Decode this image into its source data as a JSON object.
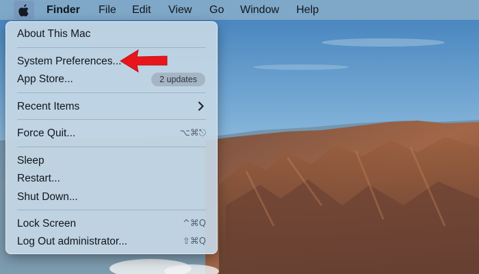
{
  "menubar": {
    "apple_icon": "apple-logo-icon",
    "items": [
      {
        "label": "Finder",
        "bold": true
      },
      {
        "label": "File"
      },
      {
        "label": "Edit"
      },
      {
        "label": "View"
      },
      {
        "label": "Go"
      },
      {
        "label": "Window"
      },
      {
        "label": "Help"
      }
    ]
  },
  "apple_menu": {
    "items": [
      {
        "label": "About This Mac"
      },
      {
        "label": "System Preferences..."
      },
      {
        "label": "App Store...",
        "badge": "2 updates"
      },
      {
        "label": "Recent Items",
        "submenu_icon": "chevron-right-icon"
      },
      {
        "label": "Force Quit...",
        "shortcut": "⌥⌘⎋"
      },
      {
        "label": "Sleep"
      },
      {
        "label": "Restart..."
      },
      {
        "label": "Shut Down..."
      },
      {
        "label": "Lock Screen",
        "shortcut": "^⌘Q"
      },
      {
        "label": "Log Out administrator...",
        "shortcut": "⇧⌘Q"
      }
    ]
  },
  "annotation": {
    "icon": "red-arrow-icon",
    "color": "#e8161c",
    "points_to": "System Preferences..."
  },
  "colors": {
    "menubar": "#84aac8",
    "menu_bg": "#c4d6e4",
    "sky": "#7fb0d8",
    "mountain": "#8a5a42"
  }
}
